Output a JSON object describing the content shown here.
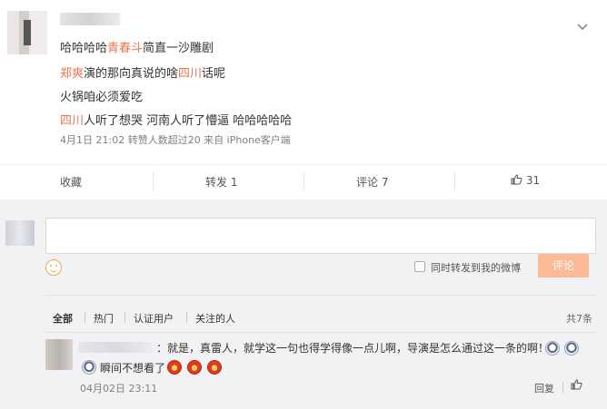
{
  "post": {
    "lines": [
      [
        {
          "t": "哈哈哈哈",
          "h": false
        },
        {
          "t": "青春斗",
          "h": true
        },
        {
          "t": "简直一沙雕剧",
          "h": false
        }
      ],
      [
        {
          "t": "郑爽",
          "h": true
        },
        {
          "t": "演的那向真说的啥",
          "h": false
        },
        {
          "t": "四川",
          "h": true
        },
        {
          "t": "话呢",
          "h": false
        }
      ],
      [
        {
          "t": "火锅咱必须爱吃",
          "h": false
        }
      ],
      [
        {
          "t": "四川",
          "h": true
        },
        {
          "t": "人听了想哭 河南人听了懵逼 哈哈哈哈哈",
          "h": false
        }
      ]
    ],
    "meta": "4月1日 21:02 转赞人数超过20 来自 iPhone客户端"
  },
  "actions": {
    "favorite": "收藏",
    "repost": "转发 1",
    "comment": "评论 7",
    "like_icon": "thumbs-up-icon",
    "like_count": "31"
  },
  "composer": {
    "forward_label": "同时转发到我的微博",
    "submit_label": "评论"
  },
  "filters": {
    "items": [
      "全部",
      "热门",
      "认证用户",
      "关注的人"
    ],
    "total": "共7条"
  },
  "comment": {
    "text1": "：就是，真雷人，就学这一句也得学得像一点儿啊，导演是怎么通过这一条的啊！？",
    "text2": "瞬间不想看了",
    "time": "04月02日 23:11",
    "reply": "回复",
    "like_icon": "thumbs-up-icon"
  },
  "colors": {
    "highlight": "#eb7350",
    "submit_bg": "#fbb995"
  }
}
